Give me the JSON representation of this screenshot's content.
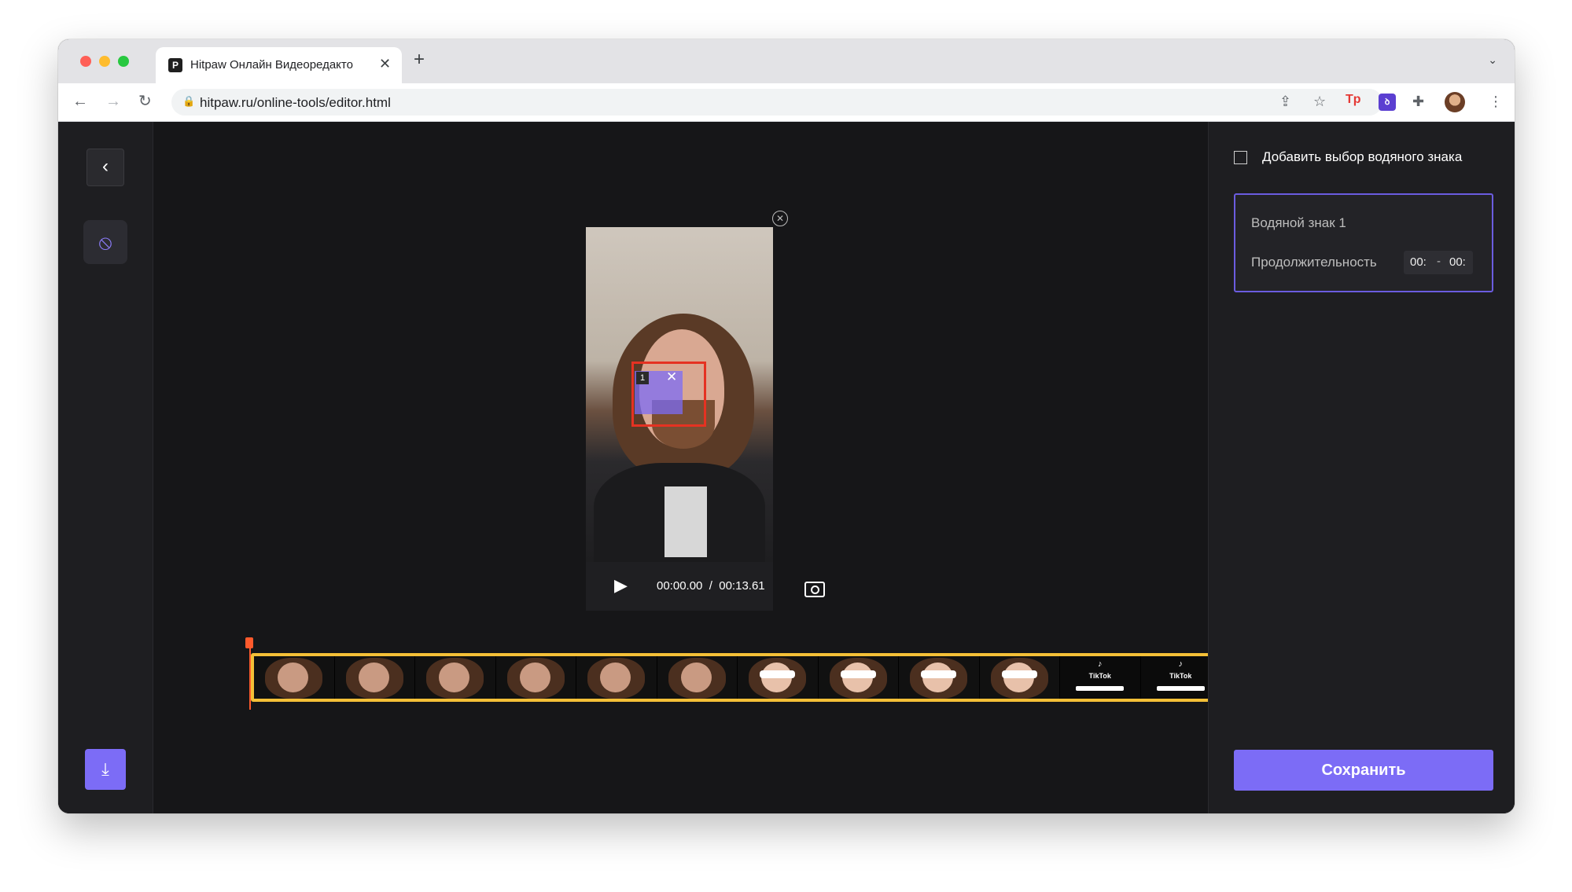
{
  "browser": {
    "tab_title": "Hitpaw Онлайн Видеоредакто",
    "tab_close": "✕",
    "new_tab": "+",
    "url": "hitpaw.ru/online-tools/editor.html",
    "extensions": {
      "tp": "Tp",
      "purple": "ꝺ"
    }
  },
  "player": {
    "current_time": "00:00.00",
    "separator": "/",
    "duration": "00:13.61",
    "watermark_index": "1"
  },
  "timeline": {
    "frames": [
      "face",
      "face",
      "face",
      "face",
      "face",
      "face",
      "sun",
      "sun",
      "sun",
      "sun",
      "tiktok",
      "tiktok"
    ],
    "tiktok_label": "TikTok"
  },
  "panel": {
    "title": "Добавить выбор водяного знака",
    "watermark_name": "Водяной знак 1",
    "duration_label": "Продолжительность",
    "start": "00:",
    "dash": "-",
    "end": "00:",
    "save_label": "Сохранить"
  },
  "colors": {
    "accent": "#7c6cf6",
    "selection": "#e53222",
    "timeline_border": "#f4c037",
    "playhead": "#ff5a2c"
  }
}
